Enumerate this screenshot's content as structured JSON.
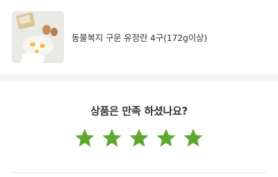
{
  "product": {
    "name": "동물복지 구운 유정란 4구(172g이상)",
    "image_icon": "egg-product-photo"
  },
  "rating": {
    "question": "상품은 만족 하셨나요?",
    "stars_total": 5,
    "stars_filled": 5,
    "star_color": "#5da82f"
  },
  "colors": {
    "band": "#f4f4f4",
    "divider": "#e4e4e4",
    "text": "#333333"
  }
}
